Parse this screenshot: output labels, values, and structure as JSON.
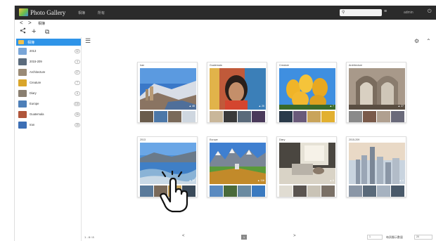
{
  "app": {
    "title": "Photo Gallery"
  },
  "topbar": {
    "tabs": [
      "相簿",
      "所有"
    ],
    "user": "admin"
  },
  "nav": {
    "back": "<",
    "forward": ">",
    "crumb": "相簿"
  },
  "toolbar": {
    "share": "<",
    "add": "+",
    "copy": "⧉"
  },
  "sidebar": {
    "header": "相簿",
    "albums": [
      {
        "name": "2013",
        "count": "32",
        "color": "#7aa6d8"
      },
      {
        "name": "2015-209",
        "count": "4",
        "color": "#5b6b7c"
      },
      {
        "name": "Architecture",
        "count": "27",
        "color": "#9a8a76"
      },
      {
        "name": "Creature",
        "count": "7",
        "color": "#d9a52a"
      },
      {
        "name": "Diary",
        "count": "6",
        "color": "#8a7f70"
      },
      {
        "name": "Europe",
        "count": "116",
        "color": "#4d7fb8"
      },
      {
        "name": "Guatemala",
        "count": "26",
        "color": "#b0553a"
      },
      {
        "name": "Iran",
        "count": "28",
        "color": "#3c6fb5"
      }
    ]
  },
  "cards": [
    {
      "title": "Iran",
      "badge": "▲ 48"
    },
    {
      "title": "Guatemala",
      "badge": "▲ 26"
    },
    {
      "title": "Creature",
      "badge": "▲ 7"
    },
    {
      "title": "Architecture",
      "badge": "▲ 27"
    },
    {
      "title": "2013",
      "badge": "▲ 32"
    },
    {
      "title": "Europe",
      "badge": "▲ 116"
    },
    {
      "title": "Diary",
      "badge": "▲ 6"
    },
    {
      "title": "2015-209",
      "badge": "▲ 4"
    }
  ],
  "footer": {
    "range": "1 - 8 / 8",
    "prev": "<",
    "next": ">",
    "page": "1",
    "per_page": "20",
    "per_page_label": "每頁顯示數量",
    "per_page_value": "20"
  }
}
